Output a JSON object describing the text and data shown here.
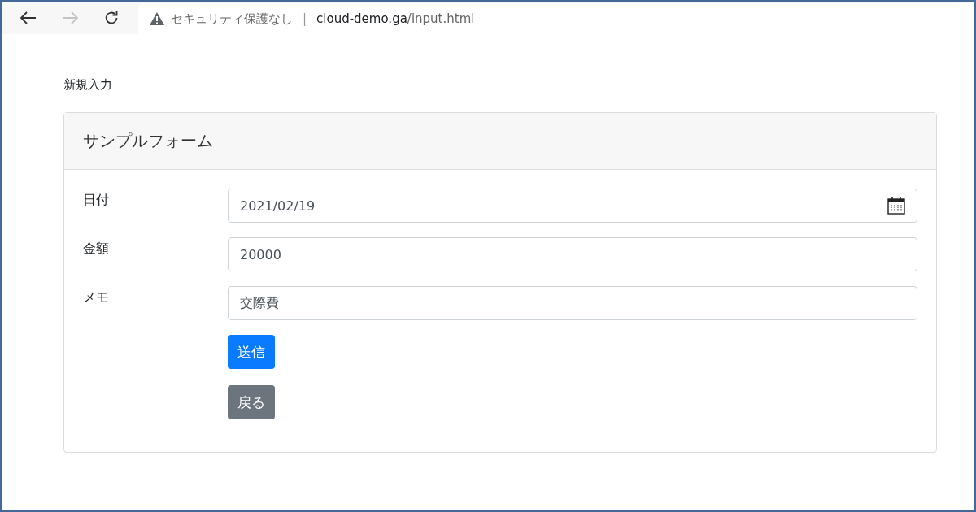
{
  "browser": {
    "nav_buttons": [
      {
        "kind": "back",
        "disabled": false
      },
      {
        "kind": "forward",
        "disabled": true
      },
      {
        "kind": "reload",
        "disabled": false
      }
    ],
    "address": {
      "security_label": "セキュリティ保護なし",
      "separator": "|",
      "domain": "cloud-demo.ga",
      "path": "/input.html"
    }
  },
  "breadcrumb": "新規入力",
  "card": {
    "title": "サンプルフォーム",
    "fields": [
      {
        "label": "日付",
        "value": "2021/02/19",
        "kind": "date"
      },
      {
        "label": "金額",
        "value": "20000",
        "kind": "text"
      },
      {
        "label": "メモ",
        "value": "交際費",
        "kind": "text"
      }
    ],
    "buttons": [
      {
        "label": "送信",
        "kind": "primary"
      },
      {
        "label": "戻る",
        "kind": "secondary"
      }
    ]
  }
}
